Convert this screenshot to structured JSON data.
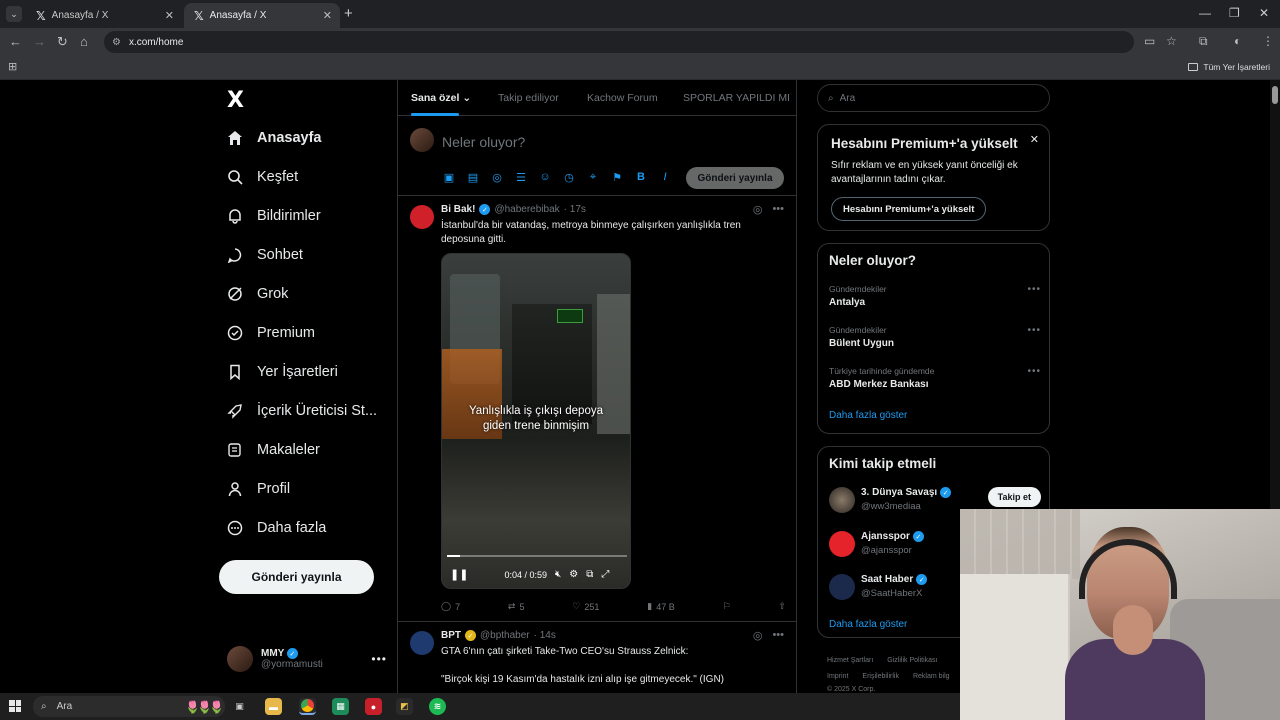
{
  "browser": {
    "tabs": [
      {
        "title": "Anasayfa / X",
        "active": false
      },
      {
        "title": "Anasayfa / X",
        "active": true
      }
    ],
    "url": "x.com/home",
    "bookmarks_all": "Tüm Yer İşaretleri"
  },
  "nav": {
    "logo": "X",
    "items": [
      {
        "label": "Anasayfa",
        "icon": "home-icon"
      },
      {
        "label": "Keşfet",
        "icon": "search-icon"
      },
      {
        "label": "Bildirimler",
        "icon": "bell-icon"
      },
      {
        "label": "Sohbet",
        "icon": "chat-icon"
      },
      {
        "label": "Grok",
        "icon": "grok-icon"
      },
      {
        "label": "Premium",
        "icon": "premium-icon"
      },
      {
        "label": "Yer İşaretleri",
        "icon": "bookmark-icon"
      },
      {
        "label": "İçerik Üreticisi St...",
        "icon": "rocket-icon"
      },
      {
        "label": "Makaleler",
        "icon": "article-icon"
      },
      {
        "label": "Profil",
        "icon": "person-icon"
      },
      {
        "label": "Daha fazla",
        "icon": "more-circle-icon"
      }
    ],
    "post_button": "Gönderi yayınla",
    "me": {
      "name": "MMY",
      "handle": "@yormamusti"
    }
  },
  "timeline": {
    "tabs": [
      "Sana özel",
      "Takip ediliyor",
      "Kachow Forum",
      "SPORLAR YAPILDI MI"
    ],
    "compose_placeholder": "Neler oluyor?",
    "compose_button": "Gönderi yayınla",
    "tweets": [
      {
        "name": "Bi Bak!",
        "handle": "@haberebibak",
        "time": "· 17s",
        "text": "İstanbul'da bir vatandaş, metroya binmeye çalışırken yanlışlıkla tren deposuna gitti.",
        "video_caption": "Yanlışlıkla iş çıkışı depoya\ngiden trene binmişim",
        "video_time": "0:04 / 0:59",
        "video_progress": 0.07,
        "replies": "7",
        "reposts": "5",
        "likes": "251",
        "views": "47 B"
      },
      {
        "name": "BPT",
        "handle": "@bpthaber",
        "time": "· 14s",
        "text": "GTA 6'nın çatı şirketi Take-Two CEO'su Strauss Zelnick:\n\n\"Birçok kişi 19 Kasım'da hastalık izni alıp işe gitmeyecek.\" (IGN)"
      }
    ]
  },
  "right": {
    "search_placeholder": "Ara",
    "premium": {
      "title": "Hesabını Premium+'a yükselt",
      "text": "Sıfır reklam ve en yüksek yanıt önceliği ek avantajlarının tadını çıkar.",
      "cta": "Hesabını Premium+'a yükselt"
    },
    "trends": {
      "title": "Neler oluyor?",
      "items": [
        {
          "category": "Gündemdekiler",
          "topic": "Antalya"
        },
        {
          "category": "Gündemdekiler",
          "topic": "Bülent Uygun"
        },
        {
          "category": "Türkiye tarihinde gündemde",
          "topic": "ABD Merkez Bankası"
        }
      ],
      "show_more": "Daha fazla göster"
    },
    "who_to_follow": {
      "title": "Kimi takip etmeli",
      "accounts": [
        {
          "name": "3. Dünya Savaşı",
          "handle": "@ww3mediaa",
          "follow": "Takip et"
        },
        {
          "name": "Ajansspor",
          "handle": "@ajansspor"
        },
        {
          "name": "Saat Haber",
          "handle": "@SaatHaberX"
        }
      ],
      "show_more": "Daha fazla göster"
    },
    "footer": {
      "row1": [
        "Hizmet Şartları",
        "Gizlilik Politikası"
      ],
      "row2": [
        "Imprint",
        "Erişilebilirlik",
        "Reklam bilg"
      ],
      "row3": "© 2025 X Corp."
    }
  },
  "taskbar": {
    "search": "Ara"
  },
  "colors": {
    "accent": "#1d9bf0",
    "background": "#000000",
    "border": "#2f3336",
    "muted": "#71767b"
  }
}
